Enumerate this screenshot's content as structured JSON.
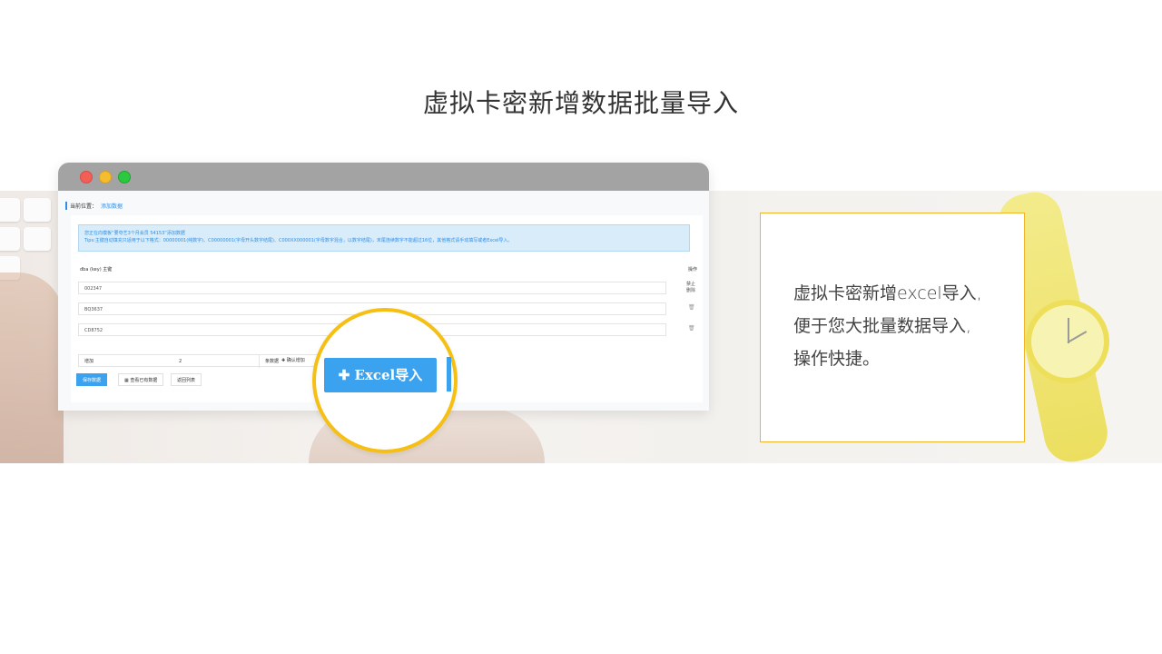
{
  "page": {
    "title": "虚拟卡密新增数据批量导入"
  },
  "screenshot": {
    "breadcrumb_label": "当前位置：",
    "breadcrumb_link": "添加数据",
    "notice_line1": "您正在向模板“要夺艺3个月会员 54153”添加数据",
    "notice_line2": "Tips:主键自动填充只适用于以下格式：00000001(纯数字)、C00000001(字母开头数字结尾)、C000XX000001(字母数字混合，以数字结尾)，末尾连续数字不能超过16位，其他格式请手动填写或者Excel导入。",
    "table_header_key": "dba (key) 主键",
    "table_header_op": "操作",
    "rows": [
      "002347",
      "BQ3637",
      "CD8752"
    ],
    "row1_op_line1": "禁止",
    "row1_op_line2": "删除",
    "trash_icon": "🗑",
    "add_label": "增加",
    "add_count": "2",
    "add_unit": "条数据",
    "confirm_add": "✚ 确认增加",
    "save_button": "保存数据",
    "view_button": "▦ 查看已有数据",
    "back_button": "返回列表"
  },
  "highlight": {
    "excel_button": "✚ Excel导入"
  },
  "description": {
    "lines": [
      "虚拟卡密新增excel导入,",
      "便于您大批量数据导入,",
      "操作快捷。"
    ]
  },
  "colors": {
    "accent": "#3aa2ee",
    "highlight_ring": "#f6bf13",
    "box_border": "#f0b429"
  }
}
